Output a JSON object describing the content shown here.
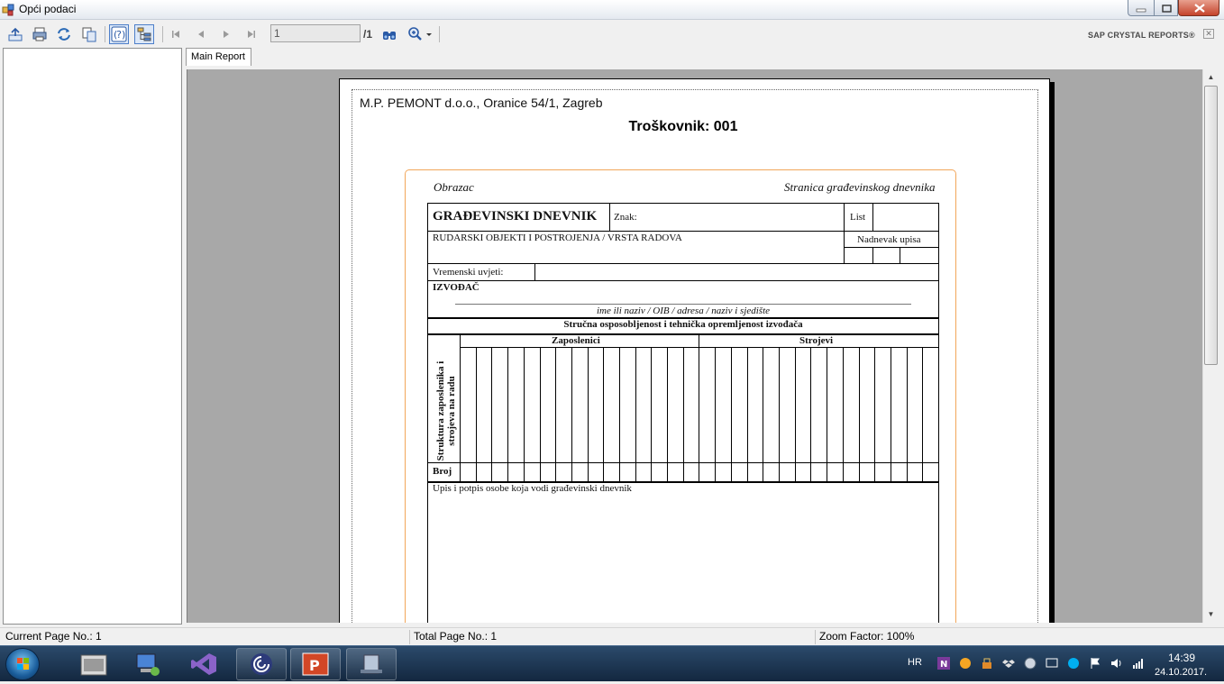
{
  "window": {
    "title": "Opći podaci"
  },
  "toolbar": {
    "page_input": "1",
    "page_total": "/1",
    "brand": "SAP CRYSTAL REPORTS®",
    "close_glyph": "✕"
  },
  "tabs": [
    {
      "label": "Main Report"
    }
  ],
  "report": {
    "company": "M.P. PEMONT d.o.o., Oranice 54/1, Zagreb",
    "title": "Troškovnik: 001"
  },
  "form": {
    "obrazac": "Obrazac",
    "stranica": "Stranica građevinskog dnevnika",
    "heading": "GRAĐEVINSKI DNEVNIK",
    "znak": "Znak:",
    "list": "List",
    "rudarski": "RUDARSKI OBJEKTI I POSTROJENJA / VRSTA RADOVA",
    "nadnevak": "Nadnevak upisa",
    "vremenski": "Vremenski uvjeti:",
    "izvodac": "IZVOĐAČ",
    "ime": "ime ili naziv / OIB / adresa / naziv i sjedište",
    "strucna": "Stručna osposobljenost i tehnička opremljenost izvođača",
    "zaposlenici": "Zaposlenici",
    "strojevi": "Strojevi",
    "struktura": "Struktura zaposlenika i strojeva na radu",
    "broj": "Broj",
    "upis": "Upis i potpis osobe koja vodi građevinski dnevnik"
  },
  "status": {
    "current": "Current Page No.: 1",
    "total": "Total Page No.: 1",
    "zoom": "Zoom Factor: 100%"
  },
  "tray": {
    "lang": "HR",
    "time": "14:39",
    "date": "24.10.2017."
  },
  "icons": [
    "export-icon",
    "print-icon",
    "refresh-icon",
    "copy-icon",
    "help-icon",
    "group-tree-icon",
    "first-page-icon",
    "prev-page-icon",
    "next-page-icon",
    "last-page-icon",
    "find-icon",
    "zoom-icon"
  ]
}
